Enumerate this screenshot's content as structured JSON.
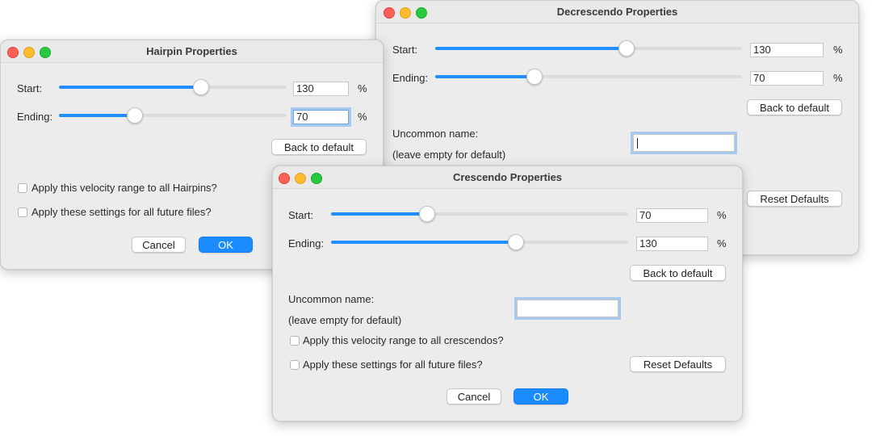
{
  "decrescendo": {
    "title": "Decrescendo Properties",
    "start_label": "Start:",
    "start_value": "130",
    "start_fraction": 0.62,
    "ending_label": "Ending:",
    "ending_value": "70",
    "ending_fraction": 0.32,
    "percent": "%",
    "back_to_default": "Back to default",
    "uncommon_name_label": "Uncommon name:",
    "uncommon_name_hint": "(leave empty for default)",
    "uncommon_name_value": "",
    "reset_defaults": "Reset Defaults"
  },
  "hairpin": {
    "title": "Hairpin Properties",
    "start_label": "Start:",
    "start_value": "130",
    "start_fraction": 0.62,
    "ending_label": "Ending:",
    "ending_value": "70",
    "ending_fraction": 0.33,
    "percent": "%",
    "back_to_default": "Back to default",
    "apply_range": "Apply this velocity range to all Hairpins?",
    "apply_future": "Apply these settings for all future files?",
    "cancel": "Cancel",
    "ok": "OK"
  },
  "crescendo": {
    "title": "Crescendo Properties",
    "start_label": "Start:",
    "start_value": "70",
    "start_fraction": 0.32,
    "ending_label": "Ending:",
    "ending_value": "130",
    "ending_fraction": 0.62,
    "percent": "%",
    "back_to_default": "Back to default",
    "uncommon_name_label": "Uncommon name:",
    "uncommon_name_hint": "(leave empty for default)",
    "uncommon_name_value": "",
    "apply_range": "Apply this velocity range to all crescendos?",
    "apply_future": "Apply these settings for all future files?",
    "reset_defaults": "Reset Defaults",
    "cancel": "Cancel",
    "ok": "OK"
  },
  "colors": {
    "accent": "#1a8cff",
    "slider_fill": "#1f8fff",
    "close": "#fe5f57",
    "minimize": "#febc2e",
    "maximize": "#28c840"
  }
}
